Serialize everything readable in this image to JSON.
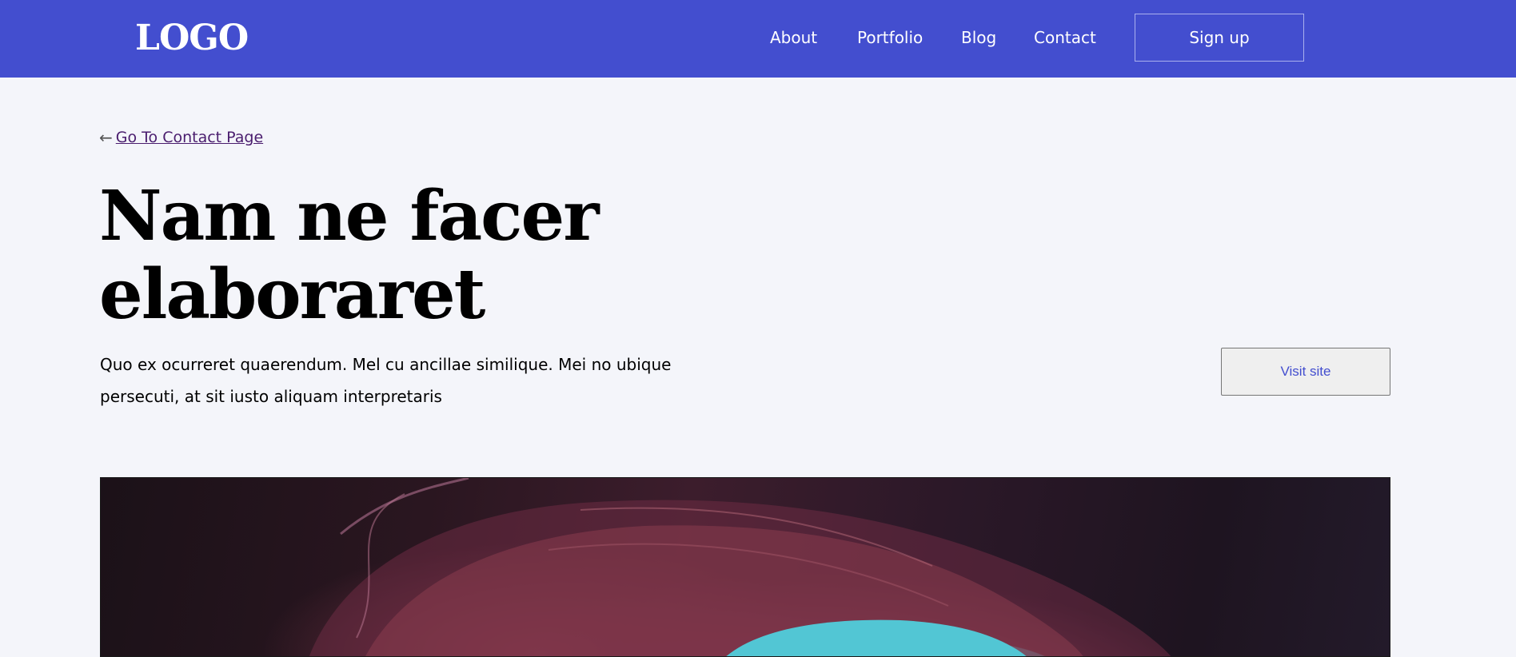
{
  "header": {
    "logo": "LOGO",
    "nav": [
      "About",
      "Portfolio",
      "Blog",
      "Contact"
    ],
    "signup_label": "Sign up",
    "bg_color": "#434ecf"
  },
  "main": {
    "back_link": {
      "arrow": "←",
      "label": "Go To Contact Page"
    },
    "title_line1": "Nam ne facer",
    "title_line2": "elaboraret",
    "lead_line1": "Quo ex ocurreret quaerendum. Mel cu ancillae similique. Mei no ubique",
    "lead_line2": "persecuti, at sit iusto aliquam interpretaris",
    "visit_label": "Visit site",
    "hero_image": "canyon-rock-photo"
  }
}
